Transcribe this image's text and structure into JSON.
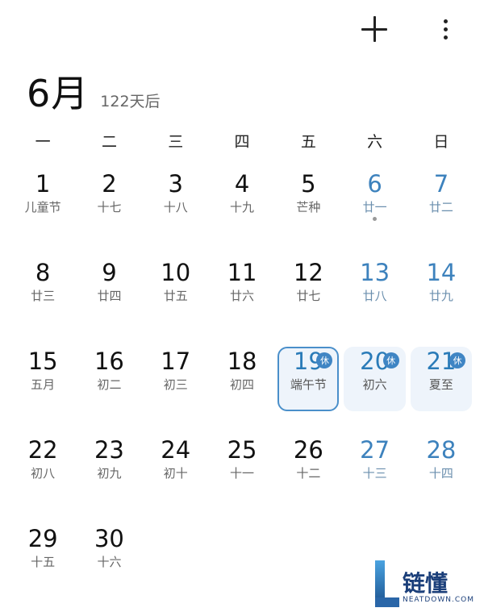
{
  "toolbar": {
    "add_icon": "plus-icon",
    "more_icon": "more-vertical-icon"
  },
  "header": {
    "month": "6月",
    "subtitle": "122天后"
  },
  "weekdays": [
    "一",
    "二",
    "三",
    "四",
    "五",
    "六",
    "日"
  ],
  "days": [
    {
      "day": "1",
      "lunar": "儿童节"
    },
    {
      "day": "2",
      "lunar": "十七"
    },
    {
      "day": "3",
      "lunar": "十八"
    },
    {
      "day": "4",
      "lunar": "十九"
    },
    {
      "day": "5",
      "lunar": "芒种"
    },
    {
      "day": "6",
      "lunar": "廿一",
      "weekend": true,
      "event": true
    },
    {
      "day": "7",
      "lunar": "廿二",
      "weekend": true
    },
    {
      "day": "8",
      "lunar": "廿三"
    },
    {
      "day": "9",
      "lunar": "廿四"
    },
    {
      "day": "10",
      "lunar": "廿五"
    },
    {
      "day": "11",
      "lunar": "廿六"
    },
    {
      "day": "12",
      "lunar": "廿七"
    },
    {
      "day": "13",
      "lunar": "廿八",
      "weekend": true
    },
    {
      "day": "14",
      "lunar": "廿九",
      "weekend": true
    },
    {
      "day": "15",
      "lunar": "五月"
    },
    {
      "day": "16",
      "lunar": "初二"
    },
    {
      "day": "17",
      "lunar": "初三"
    },
    {
      "day": "18",
      "lunar": "初四"
    },
    {
      "day": "19",
      "lunar": "端午节",
      "holiday": true,
      "badge": "休",
      "selected": true
    },
    {
      "day": "20",
      "lunar": "初六",
      "holiday": true,
      "badge": "休"
    },
    {
      "day": "21",
      "lunar": "夏至",
      "holiday": true,
      "badge": "休"
    },
    {
      "day": "22",
      "lunar": "初八"
    },
    {
      "day": "23",
      "lunar": "初九"
    },
    {
      "day": "24",
      "lunar": "初十"
    },
    {
      "day": "25",
      "lunar": "十一"
    },
    {
      "day": "26",
      "lunar": "十二"
    },
    {
      "day": "27",
      "lunar": "十三",
      "weekend": true
    },
    {
      "day": "28",
      "lunar": "十四",
      "weekend": true
    },
    {
      "day": "29",
      "lunar": "十五"
    },
    {
      "day": "30",
      "lunar": "十六"
    }
  ],
  "watermark": {
    "cn": "链懂",
    "en": "NEATDOWN.COM"
  },
  "colors": {
    "accent": "#3d82bd",
    "holiday_bg": "#eef4fb",
    "badge": "#3f85c4"
  }
}
